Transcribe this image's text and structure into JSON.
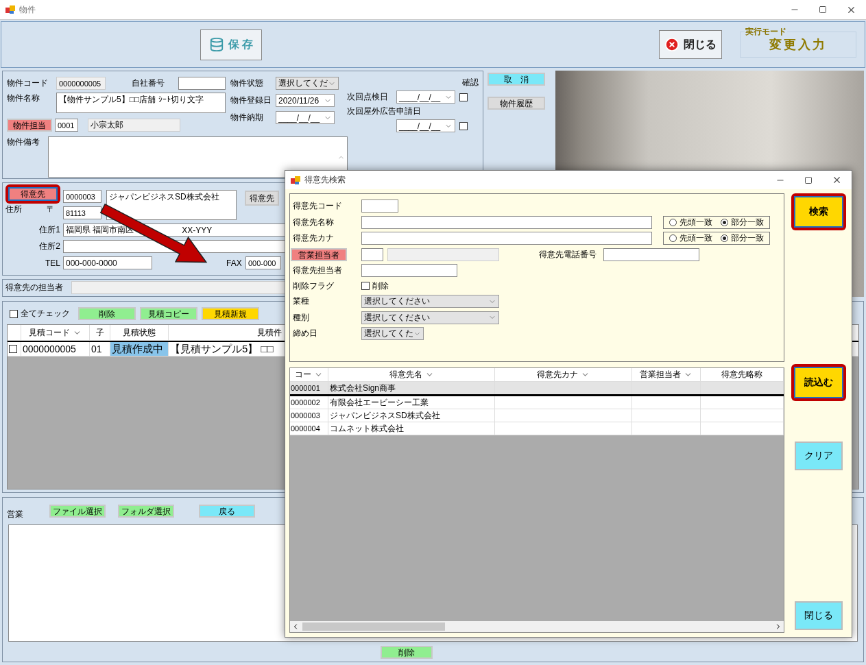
{
  "window": {
    "title": "物件"
  },
  "toolbar": {
    "save": "保 存",
    "close": "閉じる",
    "mode_label": "実行モード",
    "mode_value": "変更入力"
  },
  "property": {
    "code_label": "物件コード",
    "code": "0000000005",
    "own_no_label": "自社番号",
    "name_label": "物件名称",
    "name": "【物件サンプル5】□□店舗 ｼｰﾄ切り文字",
    "staff_button": "物件担当",
    "staff_code": "0001",
    "staff_name": "小宗太郎",
    "remarks_label": "物件備考",
    "status_label": "物件状態",
    "status": "選択してくだ",
    "registered_label": "物件登録日",
    "registered": "2020/11/26",
    "delivery_label": "物件納期",
    "delivery": "____/__/__",
    "confirm_label": "確認",
    "inspection_label": "次回点検日",
    "inspection": "____/__/__",
    "inspection_checked": false,
    "ad_label": "次回屋外広告申請日",
    "ad": "____/__/__",
    "ad_checked": false
  },
  "side_buttons": [
    {
      "label": "取　消",
      "kind": "cyan"
    },
    {
      "label": "物件履歴",
      "kind": "grey"
    }
  ],
  "customer": {
    "button": {
      "label": "得意先",
      "highlighted": true
    },
    "code": "0000003",
    "name": "ジャパンビジネスSD株式会社",
    "lookup_button": "得意先",
    "address_label": "住所",
    "postal_mark": "〒",
    "postal": "81113",
    "address1_label": "住所1",
    "address1_start": "福岡県 福岡市南区",
    "address1_end": "XX-YYY",
    "address2_label": "住所2",
    "tel_label": "TEL",
    "tel": "000-000-0000",
    "fax_label": "FAX",
    "fax": "000-000"
  },
  "contact": {
    "label": "得意先の担当者"
  },
  "estimates": {
    "check_all": {
      "label": "全てチェック",
      "checked": false
    },
    "buttons": [
      {
        "label": "削除",
        "kind": "green"
      },
      {
        "label": "見積コピー",
        "kind": "green"
      },
      {
        "label": "見積新規",
        "kind": "yellow"
      }
    ],
    "columns": [
      {
        "label": "見積コード",
        "filter": true
      },
      {
        "label": "子",
        "filter": false
      },
      {
        "label": "見積状態",
        "filter": false
      },
      {
        "label": "見積件",
        "filter": false
      }
    ],
    "rows": [
      {
        "checked": false,
        "code": "0000000005",
        "child": "01",
        "status": "見積作成中",
        "title": "【見積サンプル5】 □□"
      }
    ]
  },
  "files": {
    "label": "営業",
    "buttons": [
      {
        "label": "ファイル選択",
        "kind": "green"
      },
      {
        "label": "フォルダ選択",
        "kind": "green"
      },
      {
        "label": "戻る",
        "kind": "cyan"
      }
    ],
    "delete_button": "削除"
  },
  "dialog": {
    "title": "得意先検索",
    "fields": [
      {
        "kind": "code",
        "label": "得意先コード"
      },
      {
        "kind": "match",
        "label": "得意先名称",
        "options": [
          {
            "label": "先頭一致",
            "selected": false
          },
          {
            "label": "部分一致",
            "selected": true
          }
        ]
      },
      {
        "kind": "match",
        "label": "得意先カナ",
        "options": [
          {
            "label": "先頭一致",
            "selected": false
          },
          {
            "label": "部分一致",
            "selected": true
          }
        ]
      },
      {
        "kind": "staff",
        "label": "営業担当者",
        "phone_label": "得意先電話番号"
      },
      {
        "kind": "text",
        "label": "得意先担当者"
      },
      {
        "kind": "check",
        "label": "削除フラグ",
        "check_label": "削除",
        "checked": false
      },
      {
        "kind": "select",
        "label": "業種",
        "value": "選択してください"
      },
      {
        "kind": "select",
        "label": "種別",
        "value": "選択してください"
      },
      {
        "kind": "select_short",
        "label": "締め日",
        "value": "選択してくた"
      }
    ],
    "buttons": [
      {
        "label": "検索",
        "kind": "yellow",
        "highlighted": true
      },
      {
        "label": "読込む",
        "kind": "yellow",
        "highlighted": true
      },
      {
        "label": "クリア",
        "kind": "cyan",
        "highlighted": false
      },
      {
        "label": "閉じる",
        "kind": "cyan",
        "highlighted": false
      }
    ],
    "grid": {
      "columns": [
        {
          "label": "コー",
          "filter": true
        },
        {
          "label": "得意先名",
          "filter": true
        },
        {
          "label": "得意先カナ",
          "filter": true
        },
        {
          "label": "営業担当者",
          "filter": true
        },
        {
          "label": "得意先略称",
          "filter": false
        }
      ],
      "rows": [
        {
          "code": "0000001",
          "name": "株式会社Sign商事",
          "selected": true
        },
        {
          "code": "0000002",
          "name": "有限会社エービーシー工業",
          "selected": false
        },
        {
          "code": "0000003",
          "name": "ジャパンビジネスSD株式会社",
          "selected": false
        },
        {
          "code": "0000004",
          "name": "コムネット株式会社",
          "selected": false
        }
      ]
    }
  }
}
